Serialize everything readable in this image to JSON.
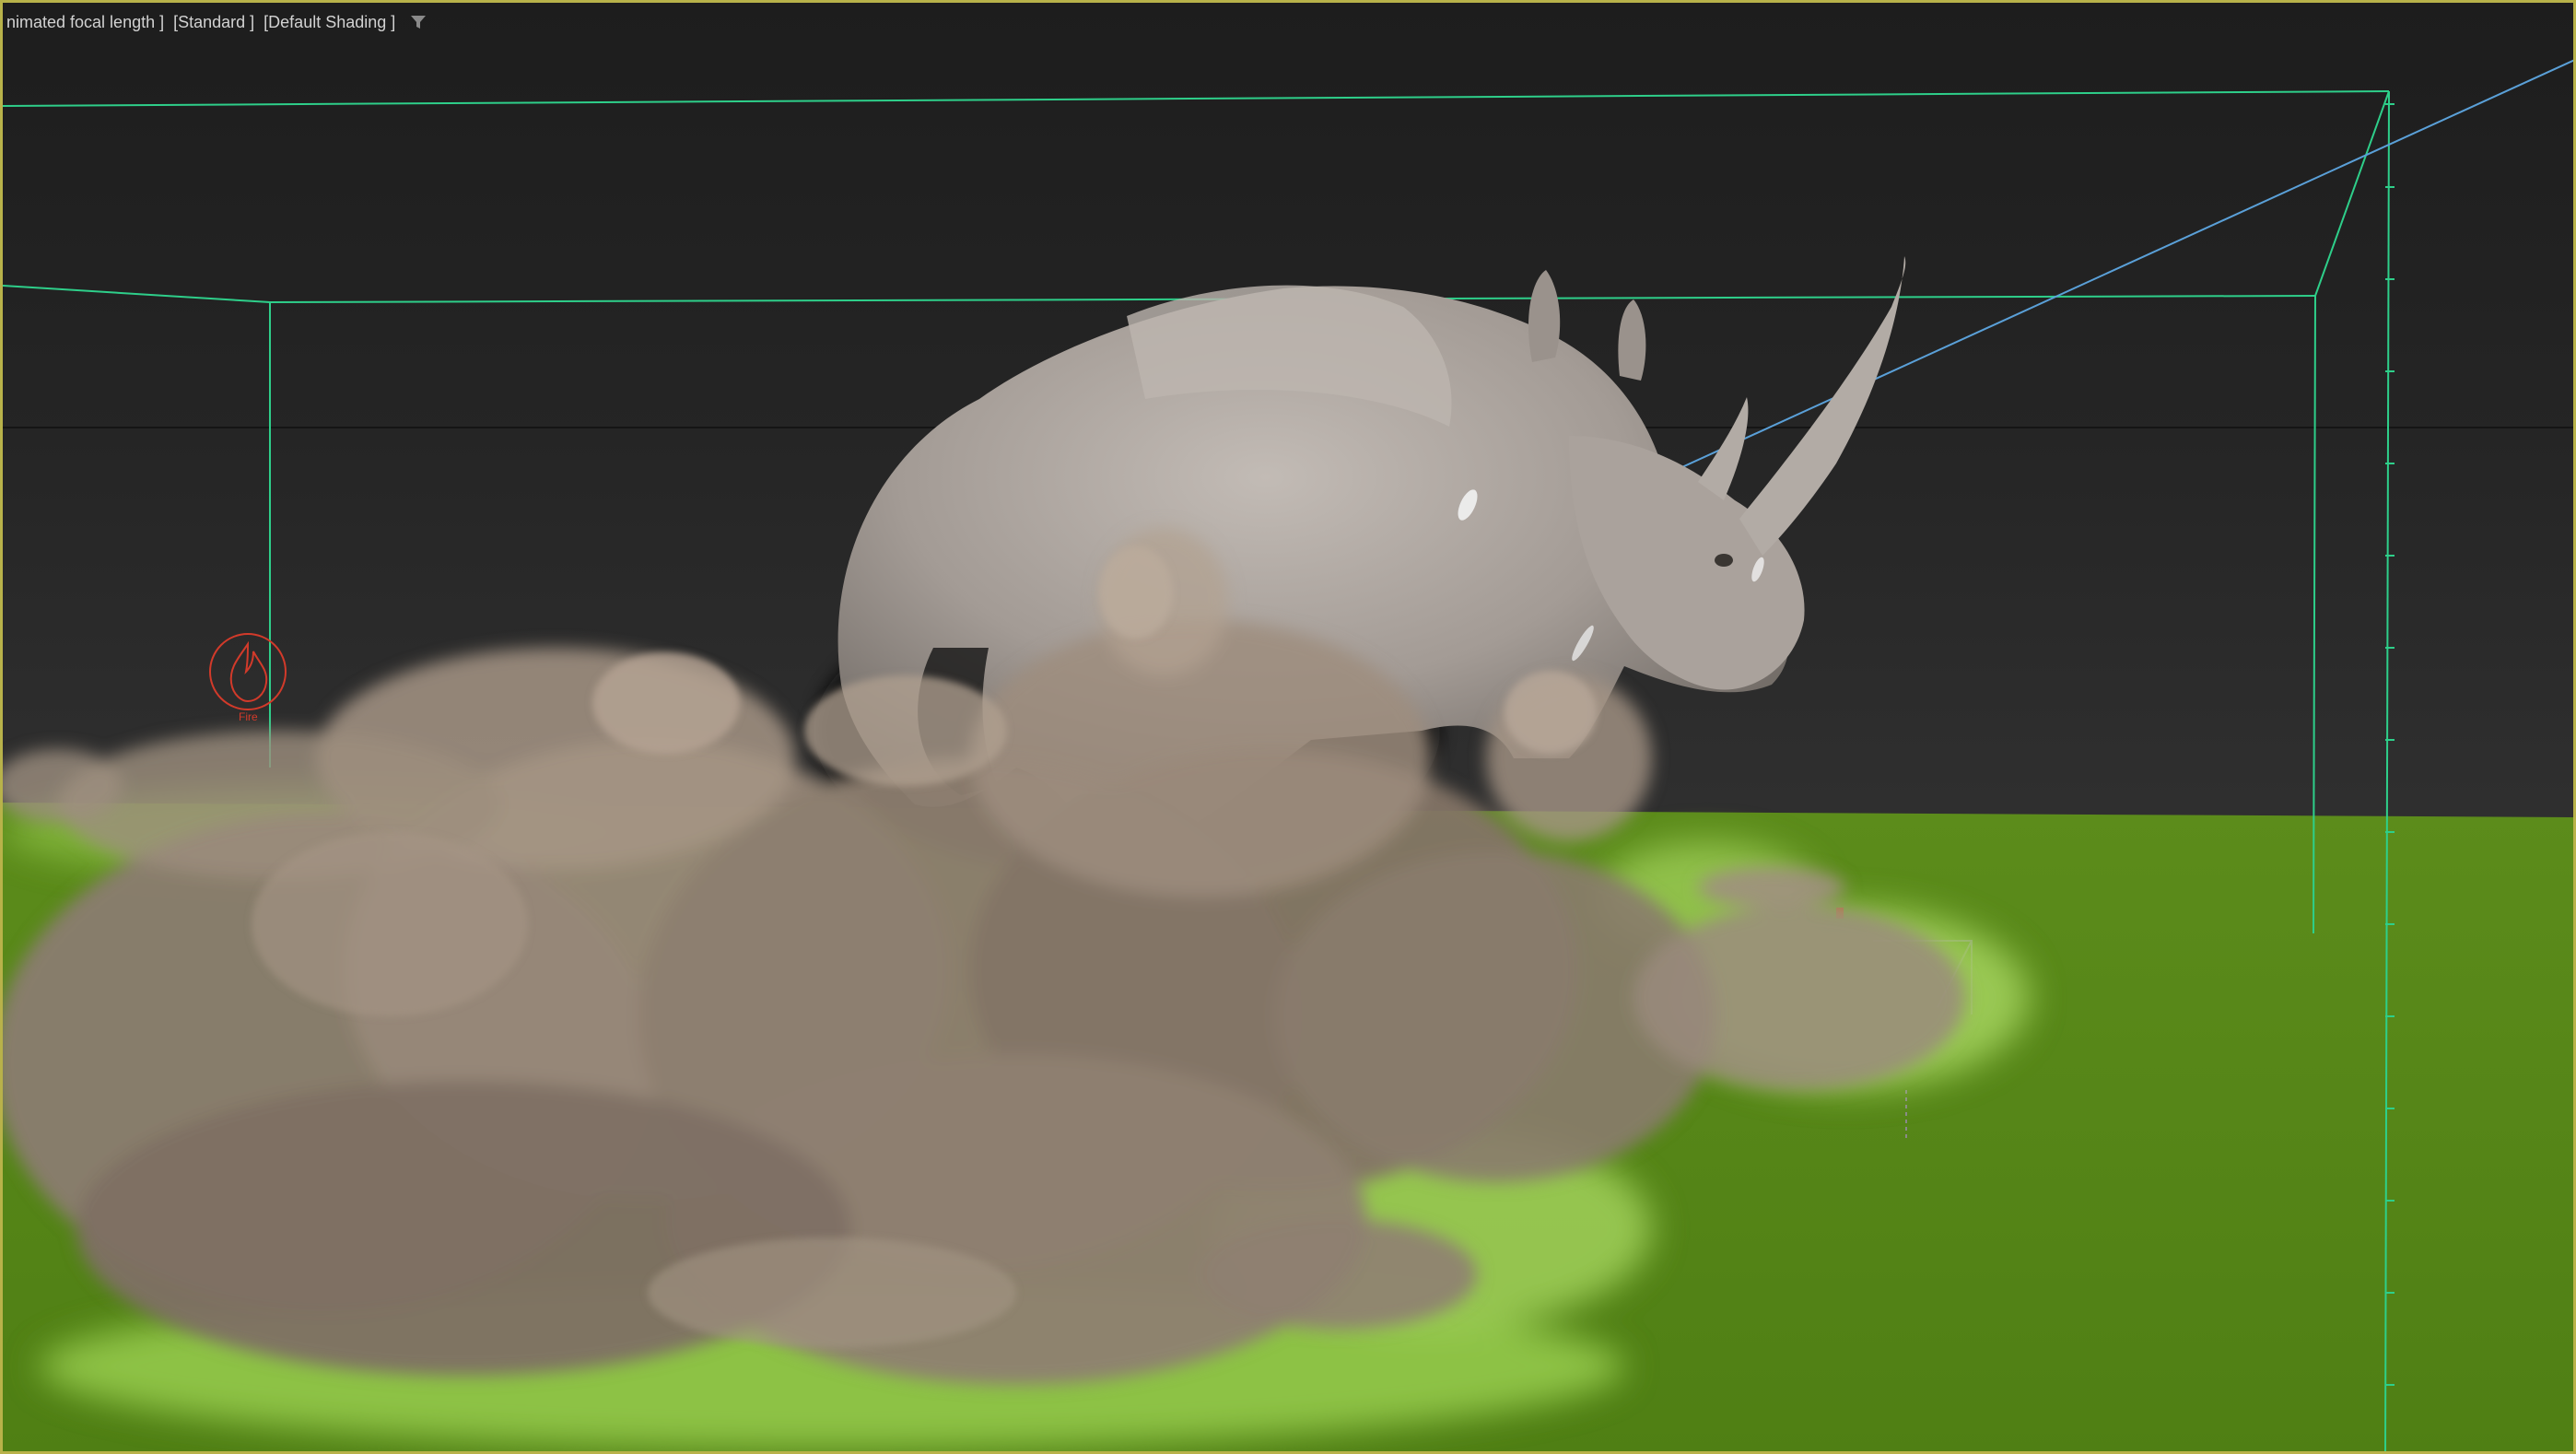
{
  "viewport": {
    "label_parts": [
      "nimated focal length ]",
      "[Standard ]",
      "[Default Shading ]"
    ],
    "filter_icon": "filter-funnel-icon",
    "border_color": "#b8b24a"
  },
  "scene": {
    "ground_color": "#5a8a1a",
    "bounding_box_color": "#2ecf8a",
    "camera_line_color": "#5aa0d8",
    "smoke_color": "#a89484",
    "rhino_color": "#a49c96"
  },
  "fire_helper": {
    "icon": "fire-icon",
    "label": "Fire",
    "color": "#d23a2a"
  }
}
